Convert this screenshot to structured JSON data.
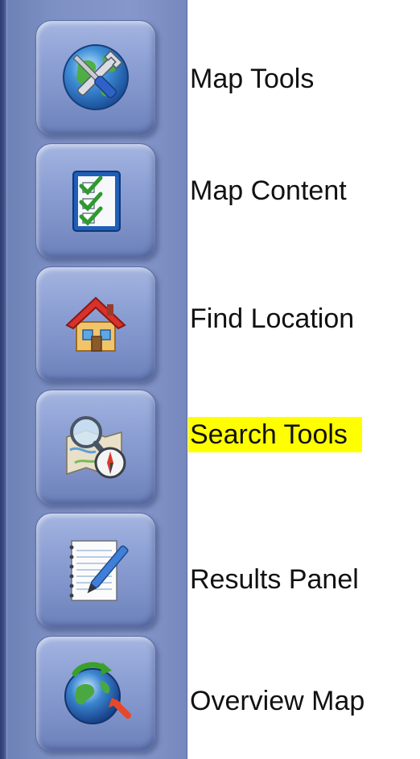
{
  "toolbar": {
    "items": [
      {
        "id": "map-tools",
        "label": "Map Tools",
        "icon": "map-tools-icon"
      },
      {
        "id": "map-content",
        "label": "Map Content",
        "icon": "checklist-icon"
      },
      {
        "id": "find-location",
        "label": "Find Location",
        "icon": "house-icon"
      },
      {
        "id": "search-tools",
        "label": "Search Tools",
        "icon": "magnifier-compass-icon",
        "highlighted": true
      },
      {
        "id": "results-panel",
        "label": "Results Panel",
        "icon": "notepad-pen-icon"
      },
      {
        "id": "overview-map",
        "label": "Overview Map",
        "icon": "globe-arrow-icon"
      }
    ]
  },
  "colors": {
    "toolbar_background": "#7e91c5",
    "button_background": "#8ea1d5",
    "highlight": "#ffff00",
    "label_text": "#111111"
  }
}
